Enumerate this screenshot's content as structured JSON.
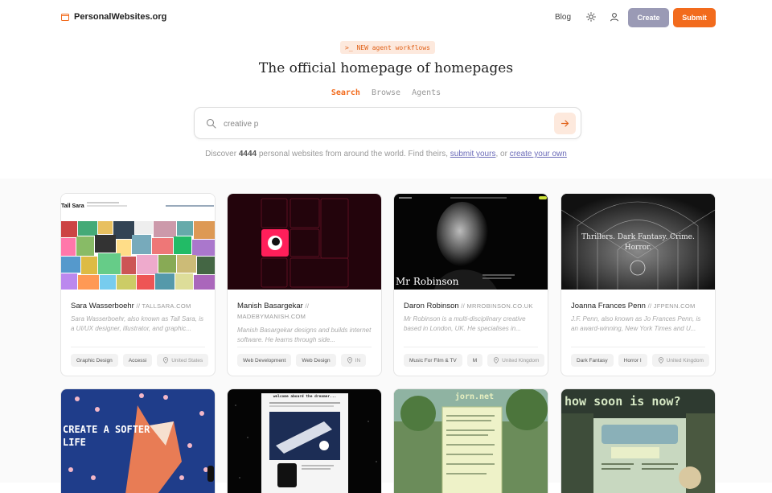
{
  "header": {
    "logo_text": "PersonalWebsites.org",
    "blog_label": "Blog",
    "create_label": "Create",
    "submit_label": "Submit"
  },
  "hero": {
    "badge": ">_ NEW agent workflows",
    "title": "The official homepage of homepages",
    "tabs": [
      "Search",
      "Browse",
      "Agents"
    ],
    "active_tab": "Search"
  },
  "search": {
    "value": "creative p"
  },
  "discover": {
    "prefix": "Discover ",
    "count": "4444",
    "middle": " personal websites from around the world. Find theirs, ",
    "submit_link": "submit yours",
    "or": ", or ",
    "create_link": "create your own"
  },
  "cards": [
    {
      "name": "Sara Wasserboehr",
      "domain": "TALLSARA.COM",
      "desc": "Sara Wasserboehr, also known as Tall Sara, is a UI/UX designer, illustrator, and graphic...",
      "tags": [
        "Graphic Design",
        "Accessi"
      ],
      "location": "United States",
      "thumb_title": "Tall Sara"
    },
    {
      "name": "Manish Basargekar",
      "domain": "MADEBYMANISH.COM",
      "desc": "Manish Basargekar designs and builds internet software. He learns through side...",
      "tags": [
        "Web Development",
        "Web Design"
      ],
      "location": "IN"
    },
    {
      "name": "Daron Robinson",
      "domain": "MRROBINSON.CO.UK",
      "desc": "Mr Robinson is a multi-disciplinary creative based in London, UK. He specialises in...",
      "tags": [
        "Music For Film & TV",
        "M"
      ],
      "location": "United Kingdom",
      "thumb_title": "Mr Robinson"
    },
    {
      "name": "Joanna Frances Penn",
      "domain": "JFPENN.COM",
      "desc": "J.F. Penn, also known as Jo Frances Penn, is an award-winning, New York Times and U...",
      "tags": [
        "Dark Fantasy",
        "Horror I"
      ],
      "location": "United Kingdom",
      "thumb_title": "Thrillers. Dark Fantasy. Crime. Horror."
    }
  ],
  "row2": [
    {
      "thumb_text": "CREATE A SOFTER LIFE"
    },
    {
      "thumb_text": "welcome aboard the dreamer..."
    },
    {
      "thumb_text": "jorn.net"
    },
    {
      "thumb_text": "how soon is now?"
    }
  ],
  "colors": {
    "accent": "#f26b1d",
    "create_button": "#9a9ab5",
    "link": "#6b6bb8"
  }
}
